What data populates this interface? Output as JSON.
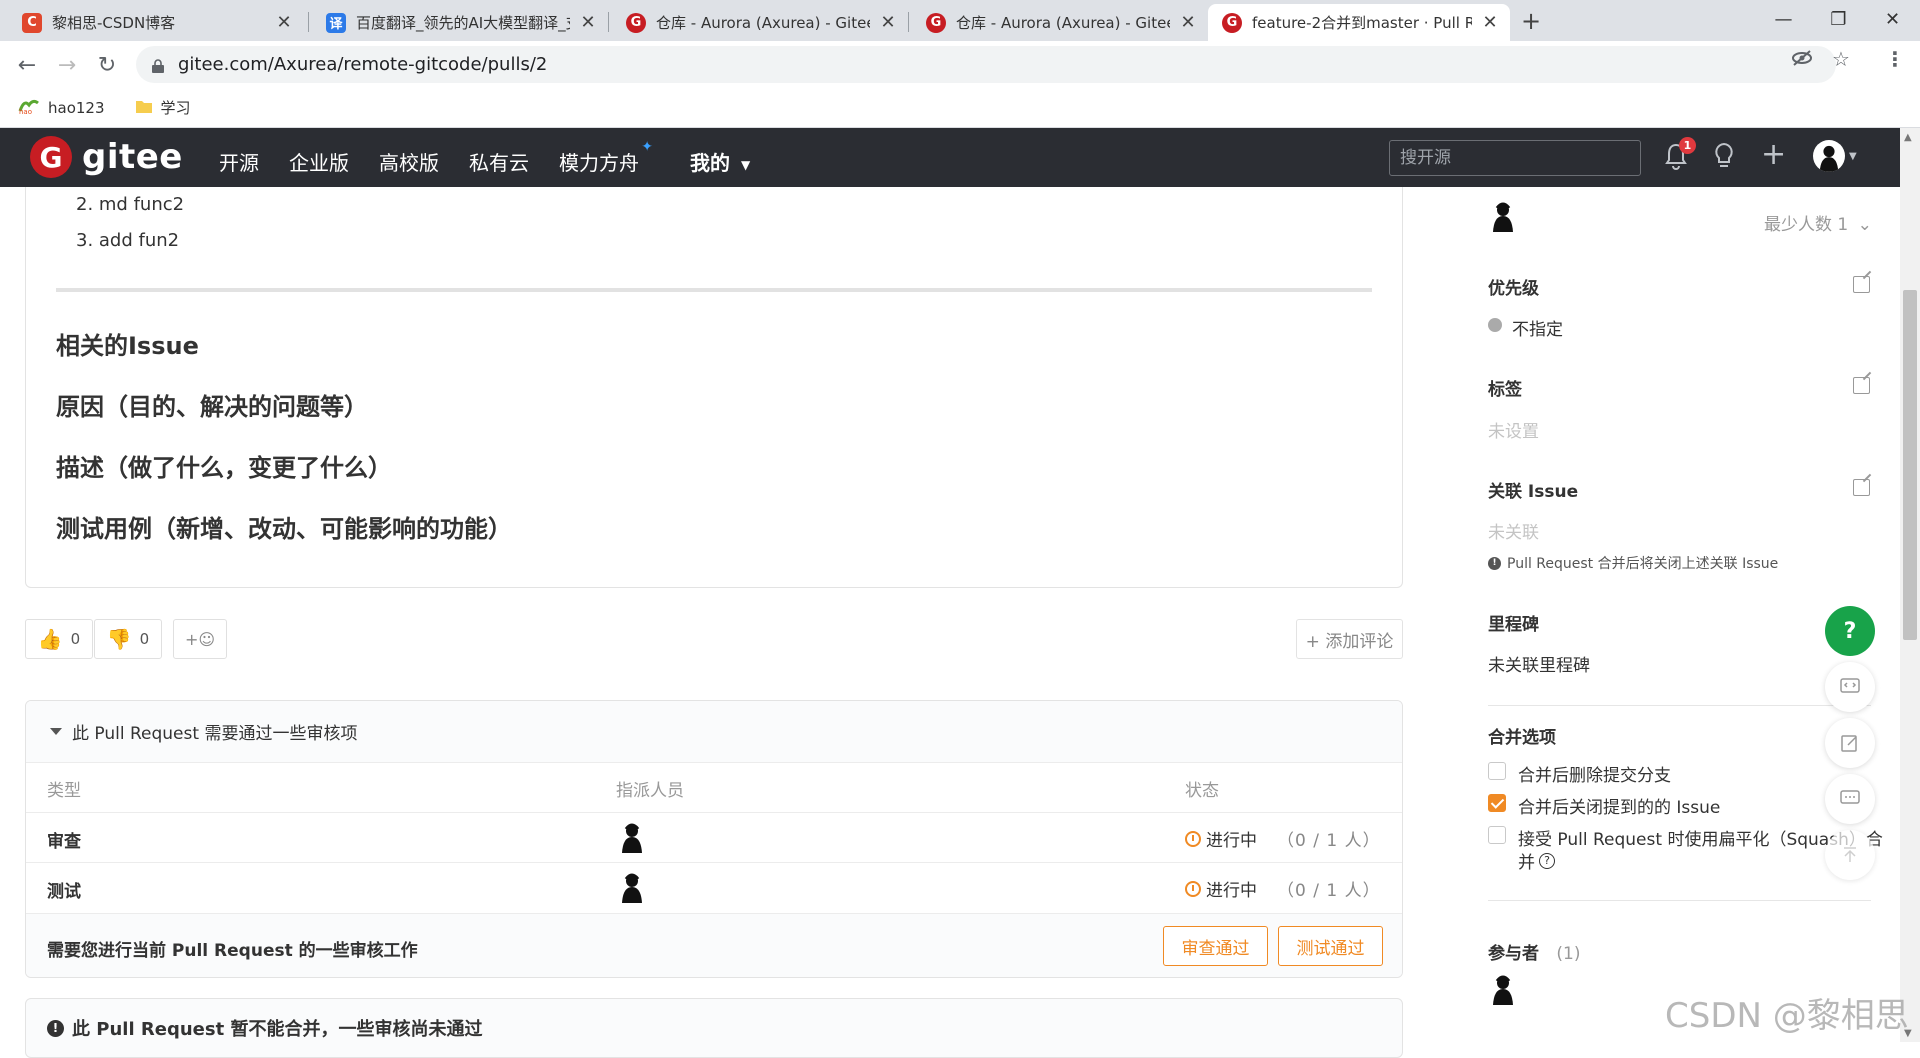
{
  "browser": {
    "tabs": [
      {
        "title": "黎相思-CSDN博客",
        "favicon_letter": "C",
        "favicon_color": "#e0472d"
      },
      {
        "title": "百度翻译_领先的AI大模型翻译_支",
        "favicon_letter": "译",
        "favicon_color": "#2c7ae8"
      },
      {
        "title": "仓库 - Aurora (Axurea) - Gitee.c",
        "favicon_letter": "G",
        "favicon_color": "#c71d23"
      },
      {
        "title": "仓库 - Aurora (Axurea) - Gitee.c",
        "favicon_letter": "G",
        "favicon_color": "#c71d23"
      },
      {
        "title": "feature-2合并到master · Pull Re",
        "favicon_letter": "G",
        "favicon_color": "#c71d23"
      }
    ],
    "new_tab": "+",
    "url": "gitee.com/Axurea/remote-gitcode/pulls/2",
    "bookmarks": [
      {
        "label": "hao123"
      },
      {
        "label": "学习"
      }
    ]
  },
  "header": {
    "logo_text": "gitee",
    "logo_letter": "G",
    "nav": [
      "开源",
      "企业版",
      "高校版",
      "私有云",
      "模力方舟",
      "我的"
    ],
    "search_placeholder": "搜开源",
    "notification_count": "1"
  },
  "description": {
    "list_items": [
      "2. md func2",
      "3. add fun2"
    ],
    "headings": [
      "相关的Issue",
      "原因（目的、解决的问题等）",
      "描述（做了什么，变更了什么）",
      "测试用例（新增、改动、可能影响的功能）"
    ]
  },
  "reactions": {
    "thumbs_up": "0",
    "thumbs_down": "0",
    "add_reaction": "+☺",
    "add_comment": "+ 添加评论"
  },
  "review": {
    "title": "此 Pull Request 需要通过一些审核项",
    "columns": [
      "类型",
      "指派人员",
      "状态"
    ],
    "rows": [
      {
        "type": "审查",
        "status": "进行中",
        "count": "（0 / 1 人）"
      },
      {
        "type": "测试",
        "status": "进行中",
        "count": "（0 / 1 人）"
      }
    ],
    "footer_message": "需要您进行当前 Pull Request 的一些审核工作",
    "approve_review": "审查通过",
    "approve_test": "测试通过"
  },
  "merge_status": "此 Pull Request 暂不能合并，一些审核尚未通过",
  "sidebar": {
    "min_people": "最少人数 1",
    "priority": {
      "title": "优先级",
      "value": "不指定"
    },
    "labels": {
      "title": "标签",
      "value": "未设置"
    },
    "related_issue": {
      "title": "关联 Issue",
      "value": "未关联",
      "note": "Pull Request 合并后将关闭上述关联 Issue"
    },
    "milestone": {
      "title": "里程碑",
      "value": "未关联里程碑"
    },
    "merge_options": {
      "title": "合并选项",
      "options": [
        {
          "label": "合并后删除提交分支",
          "checked": false
        },
        {
          "label": "合并后关闭提到的的 Issue",
          "checked": true
        },
        {
          "label": "接受 Pull Request 时使用扁平化（Squash）合",
          "checked": false
        }
      ],
      "option3_wrap": "并"
    },
    "participants": {
      "title": "参与者",
      "count": "(1)"
    }
  },
  "float_buttons": {
    "help": "?"
  },
  "watermark": "CSDN @黎相思"
}
